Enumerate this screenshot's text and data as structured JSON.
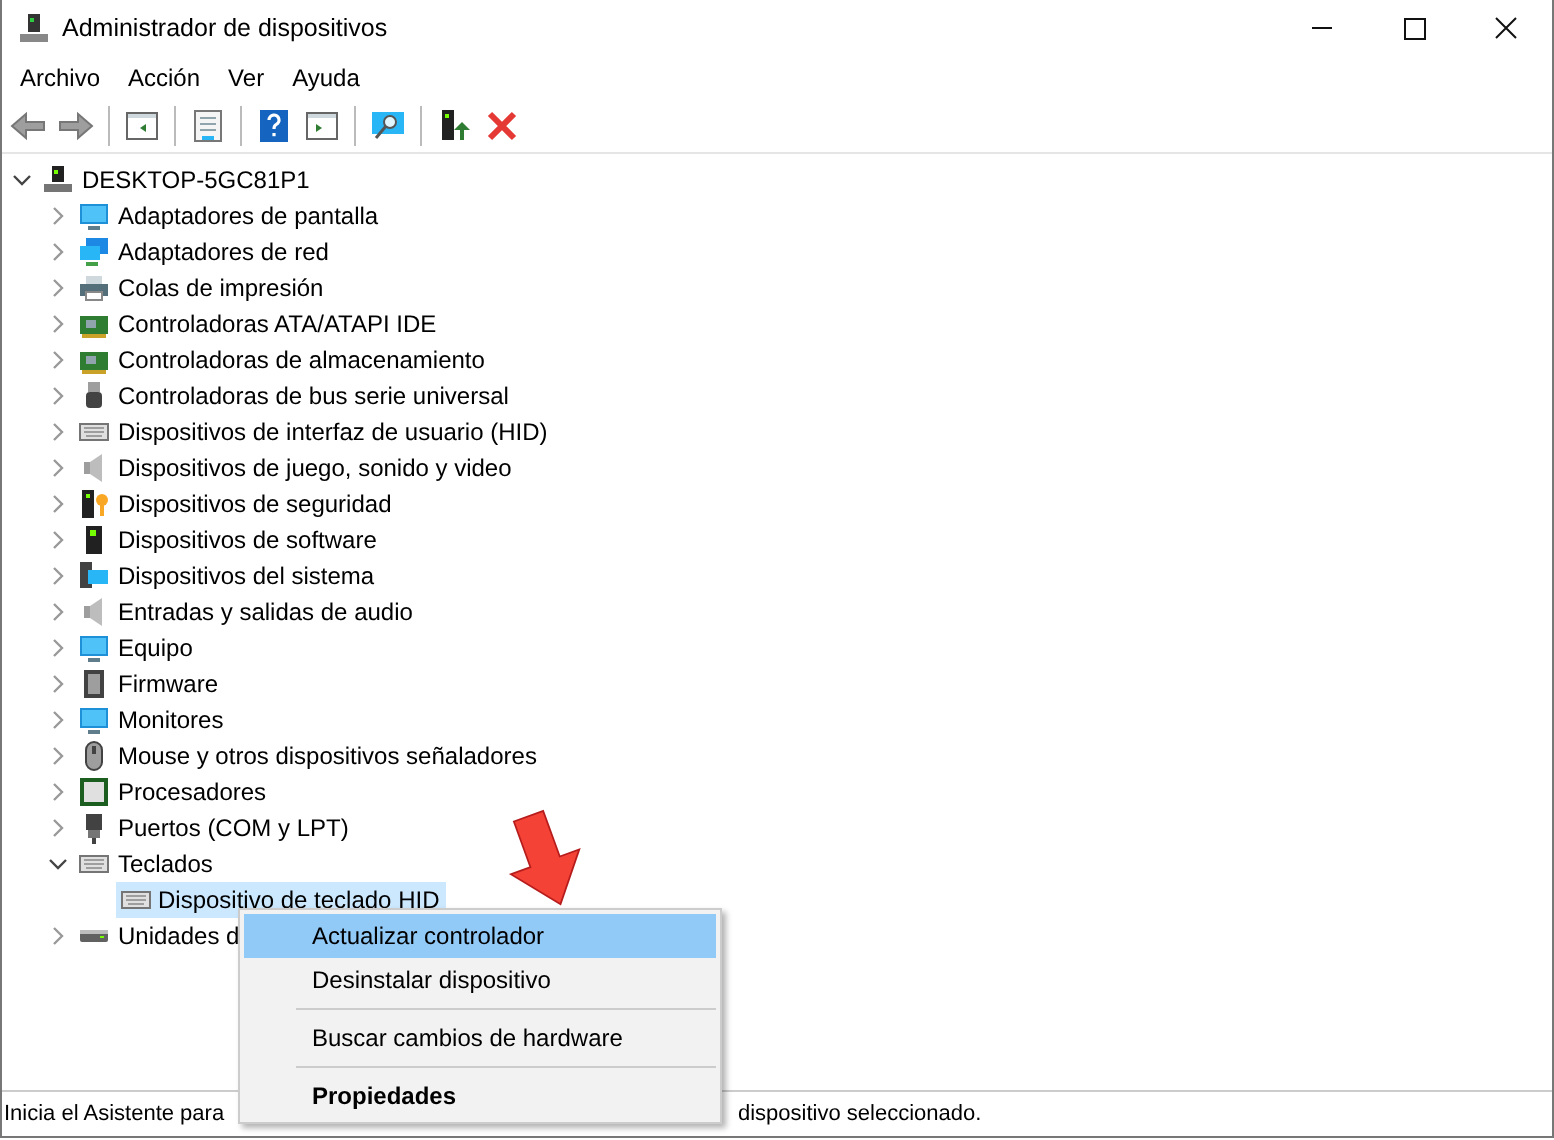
{
  "window": {
    "title": "Administrador de dispositivos"
  },
  "menu": [
    "Archivo",
    "Acción",
    "Ver",
    "Ayuda"
  ],
  "tree": {
    "label": "DESKTOP-5GC81P1",
    "expanded": true,
    "selected": false,
    "children": [
      {
        "label": "Adaptadores de pantalla",
        "expanded": false,
        "selected": false
      },
      {
        "label": "Adaptadores de red",
        "expanded": false,
        "selected": false
      },
      {
        "label": "Colas de impresión",
        "expanded": false,
        "selected": false
      },
      {
        "label": "Controladoras ATA/ATAPI IDE",
        "expanded": false,
        "selected": false
      },
      {
        "label": "Controladoras de almacenamiento",
        "expanded": false,
        "selected": false
      },
      {
        "label": "Controladoras de bus serie universal",
        "expanded": false,
        "selected": false
      },
      {
        "label": "Dispositivos de interfaz de usuario (HID)",
        "expanded": false,
        "selected": false
      },
      {
        "label": "Dispositivos de juego, sonido y video",
        "expanded": false,
        "selected": false
      },
      {
        "label": "Dispositivos de seguridad",
        "expanded": false,
        "selected": false
      },
      {
        "label": "Dispositivos de software",
        "expanded": false,
        "selected": false
      },
      {
        "label": "Dispositivos del sistema",
        "expanded": false,
        "selected": false
      },
      {
        "label": "Entradas y salidas de audio",
        "expanded": false,
        "selected": false
      },
      {
        "label": "Equipo",
        "expanded": false,
        "selected": false
      },
      {
        "label": "Firmware",
        "expanded": false,
        "selected": false
      },
      {
        "label": "Monitores",
        "expanded": false,
        "selected": false
      },
      {
        "label": "Mouse y otros dispositivos señaladores",
        "expanded": false,
        "selected": false
      },
      {
        "label": "Procesadores",
        "expanded": false,
        "selected": false
      },
      {
        "label": "Puertos (COM y LPT)",
        "expanded": false,
        "selected": false
      },
      {
        "label": "Teclados",
        "expanded": true,
        "selected": false,
        "children": [
          {
            "label": "Dispositivo de teclado HID",
            "selected": true
          }
        ]
      },
      {
        "label": "Unidades d",
        "expanded": false,
        "selected": false
      }
    ]
  },
  "context_menu": {
    "items": [
      {
        "label": "Actualizar controlador",
        "selected": true,
        "default": false,
        "separator_before": false
      },
      {
        "label": "Desinstalar dispositivo",
        "selected": false,
        "default": false,
        "separator_before": false
      },
      {
        "label": "Buscar cambios de hardware",
        "selected": false,
        "default": false,
        "separator_before": true
      },
      {
        "label": "Propiedades",
        "selected": false,
        "default": true,
        "separator_before": true
      }
    ]
  },
  "status_bar": {
    "text_start": "Inicia el Asistente para",
    "text_end": "dispositivo seleccionado."
  }
}
